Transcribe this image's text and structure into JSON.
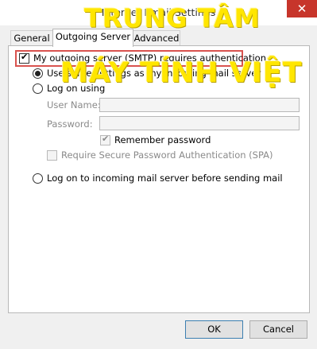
{
  "window": {
    "title": "Internet Email Settings",
    "close_glyph": "✕"
  },
  "tabs": [
    {
      "label": "General"
    },
    {
      "label": "Outgoing Server"
    },
    {
      "label": "Advanced"
    }
  ],
  "outgoing": {
    "requires_auth_label": "My outgoing server (SMTP) requires authentication",
    "requires_auth_checked": true,
    "use_same_label": "Use same settings as my incoming mail server",
    "logon_using_label": "Log on using",
    "user_name_label": "User Name:",
    "user_name_value": "",
    "password_label": "Password:",
    "password_value": "",
    "remember_label": "Remember password",
    "spa_label": "Require Secure Password Authentication (SPA)",
    "logon_incoming_label": "Log on to incoming mail server before sending mail"
  },
  "buttons": {
    "ok": "OK",
    "cancel": "Cancel"
  },
  "watermark": {
    "line1": "TRUNG TÂM",
    "line2": "MÁY TÍNH VIỆT"
  }
}
